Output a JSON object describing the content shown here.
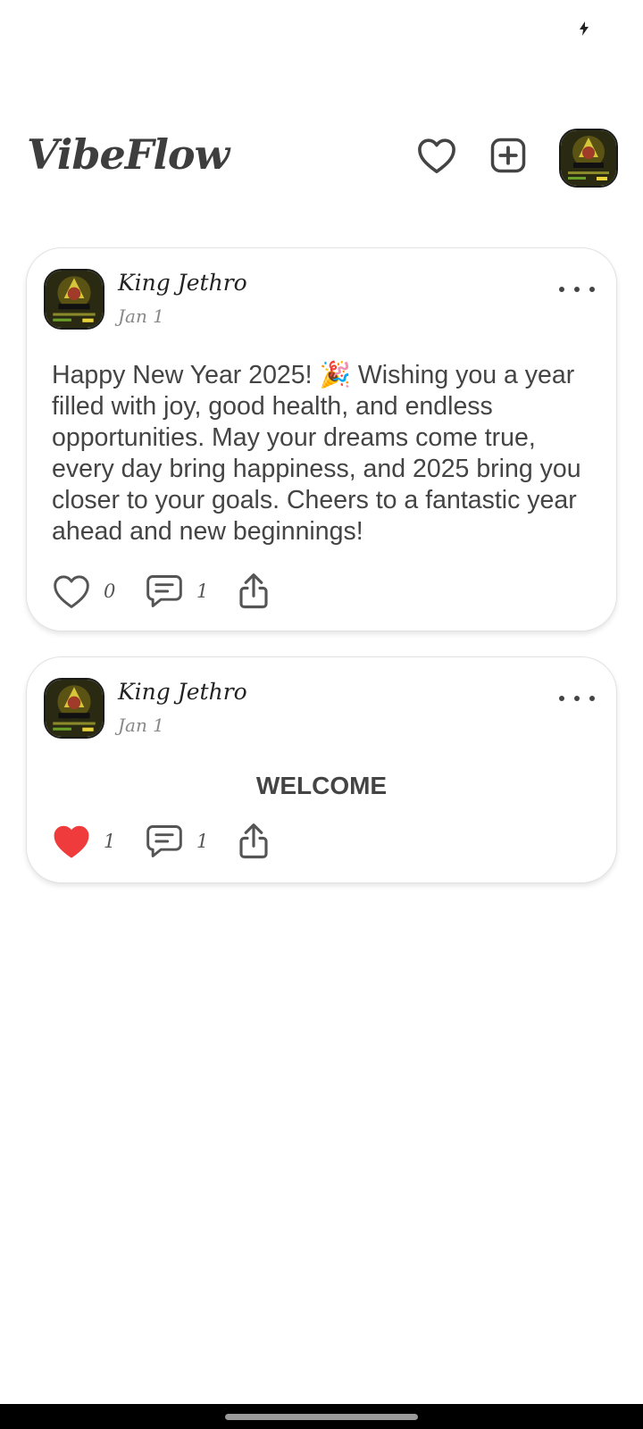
{
  "app": {
    "title": "VibeFlow"
  },
  "status_bar": {
    "icon": "charging-icon"
  },
  "header": {
    "actions": [
      {
        "name": "likes",
        "icon": "heart-outline-icon"
      },
      {
        "name": "create-post",
        "icon": "plus-square-icon"
      },
      {
        "name": "profile",
        "icon": "avatar"
      }
    ]
  },
  "posts": [
    {
      "author": "King Jethro",
      "date": "Jan 1",
      "text": "Happy New Year 2025! 🎉 Wishing you a year filled with joy, good health, and endless opportunities. May your dreams come true, every day bring happiness, and 2025 bring you closer to your goals. Cheers to a fantastic year ahead and new beginnings!",
      "likes": "0",
      "liked": false,
      "comments": "1"
    },
    {
      "author": "King Jethro",
      "date": "Jan 1",
      "text": "WELCOME",
      "likes": "1",
      "liked": true,
      "comments": "1"
    }
  ],
  "colors": {
    "liked": "#ef3b3b",
    "icon": "#555555",
    "text": "#444444"
  }
}
